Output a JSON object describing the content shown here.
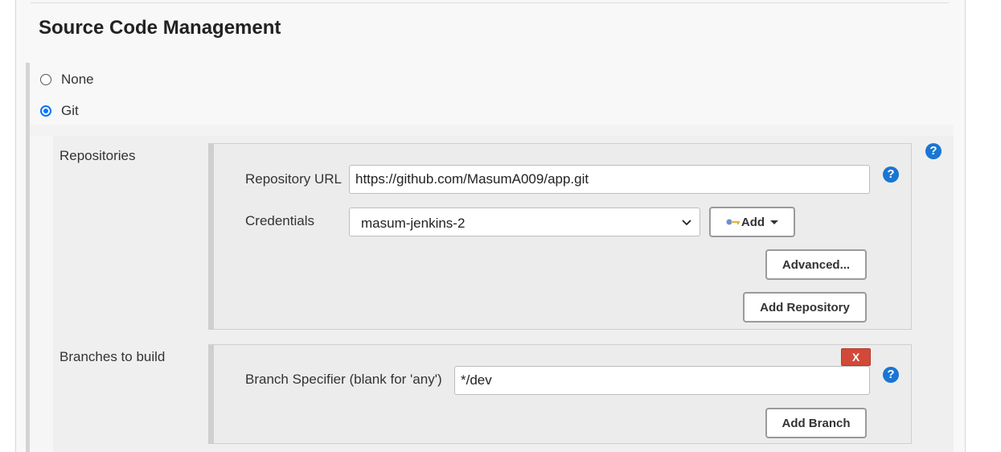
{
  "section": {
    "title": "Source Code Management"
  },
  "scm_options": [
    {
      "label": "None",
      "checked": false
    },
    {
      "label": "Git",
      "checked": true
    }
  ],
  "repositories": {
    "label": "Repositories",
    "url_label": "Repository URL",
    "url_value": "https://github.com/MasumA009/app.git",
    "credentials_label": "Credentials",
    "credentials_value": "masum-jenkins-2",
    "add_label": "Add",
    "advanced_label": "Advanced...",
    "add_repository_label": "Add Repository"
  },
  "branches": {
    "label": "Branches to build",
    "delete_label": "X",
    "specifier_label": "Branch Specifier (blank for 'any')",
    "specifier_value": "*/dev",
    "add_branch_label": "Add Branch"
  },
  "help": {
    "glyph": "?"
  },
  "colors": {
    "accent": "#1976d2",
    "radio": "#0075ff",
    "delete": "#d24939"
  },
  "icons": [
    "help-icon",
    "key-icon",
    "caret-down-icon",
    "chevron-down-icon"
  ]
}
